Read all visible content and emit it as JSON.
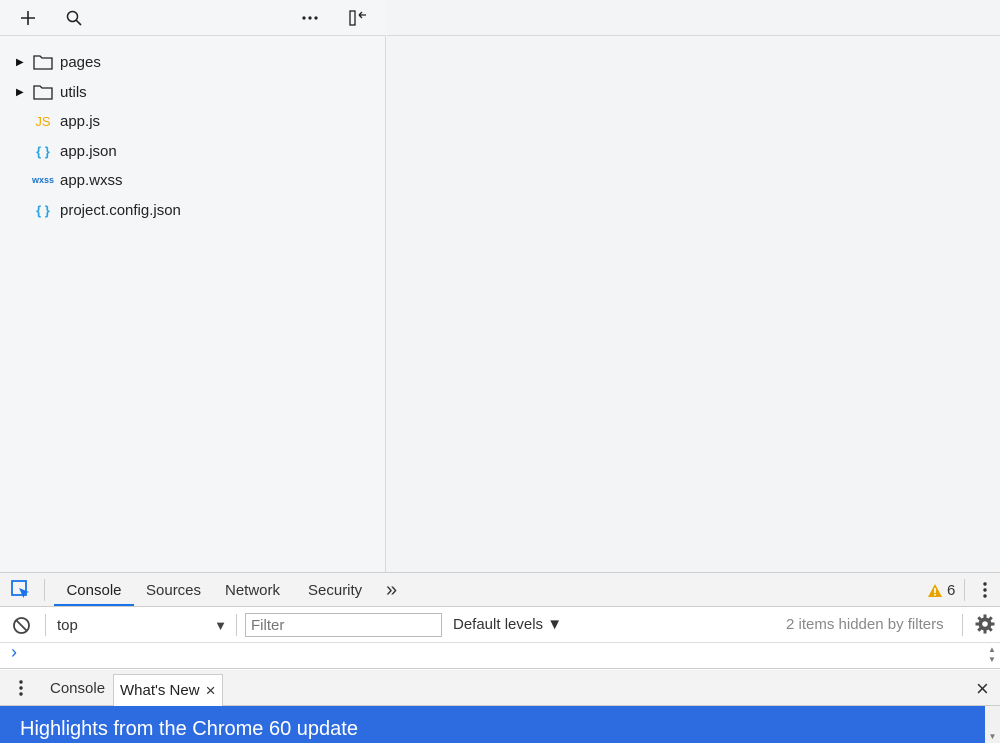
{
  "explorer": {
    "toolbar": {
      "add_icon": "plus-icon",
      "search_icon": "search-icon",
      "more_icon": "more-horizontal-icon",
      "collapse_icon": "collapse-panel-icon"
    },
    "tree": [
      {
        "type": "folder",
        "name": "pages",
        "icon": "folder-icon"
      },
      {
        "type": "folder",
        "name": "utils",
        "icon": "folder-icon"
      },
      {
        "type": "file",
        "name": "app.js",
        "badge": "JS",
        "badge_color": "#f2a900"
      },
      {
        "type": "file",
        "name": "app.json",
        "badge": "{ }",
        "badge_color": "#29a3e0"
      },
      {
        "type": "file",
        "name": "app.wxss",
        "badge": "wxss",
        "badge_color": "#1b73c9"
      },
      {
        "type": "file",
        "name": "project.config.json",
        "badge": "{ }",
        "badge_color": "#29a3e0"
      }
    ]
  },
  "devtools": {
    "tabs": [
      "Console",
      "Sources",
      "Network",
      "Security"
    ],
    "active_tab": "Console",
    "overflow_label": "»",
    "warning_count": "6",
    "console": {
      "context": "top",
      "filter_placeholder": "Filter",
      "levels": "Default levels ▼",
      "hidden_text": "2 items hidden by filters",
      "prompt": "›"
    },
    "drawer": {
      "tabs": [
        "Console",
        "What's New"
      ],
      "active_tab": "What's New",
      "close_glyph": "×"
    },
    "banner_text": "Highlights from the Chrome 60 update"
  },
  "colors": {
    "accent": "#1a73e8",
    "banner": "#2d6be0",
    "warning": "#e8a500"
  }
}
